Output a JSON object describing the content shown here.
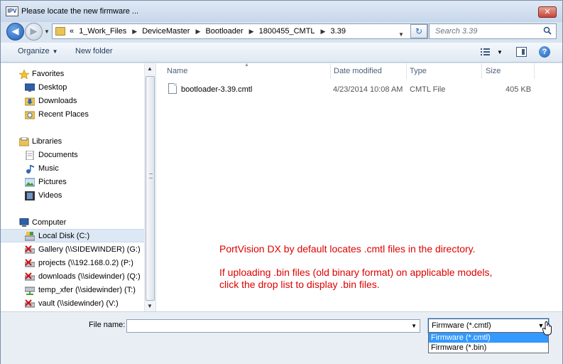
{
  "window": {
    "app_icon_text": "IPV",
    "title": "Please locate the new firmware ...",
    "close_label": "✕"
  },
  "address_bar": {
    "crumbs": [
      "«",
      "1_Work_Files",
      "DeviceMaster",
      "Bootloader",
      "1800455_CMTL",
      "3.39"
    ],
    "search_placeholder": "Search 3.39"
  },
  "toolbar": {
    "organize_label": "Organize",
    "new_folder_label": "New folder"
  },
  "nav": {
    "favorites": {
      "label": "Favorites",
      "icon": "star-icon",
      "items": [
        {
          "label": "Desktop",
          "icon": "desktop-icon"
        },
        {
          "label": "Downloads",
          "icon": "downloads-folder-icon"
        },
        {
          "label": "Recent Places",
          "icon": "recent-places-icon"
        }
      ]
    },
    "libraries": {
      "label": "Libraries",
      "icon": "libraries-icon",
      "items": [
        {
          "label": "Documents",
          "icon": "documents-icon"
        },
        {
          "label": "Music",
          "icon": "music-icon"
        },
        {
          "label": "Pictures",
          "icon": "pictures-icon"
        },
        {
          "label": "Videos",
          "icon": "videos-icon"
        }
      ]
    },
    "computer": {
      "label": "Computer",
      "icon": "computer-icon",
      "items": [
        {
          "label": "Local Disk (C:)",
          "icon": "local-disk-icon",
          "selected": true
        },
        {
          "label": "Gallery (\\\\SIDEWINDER) (G:)",
          "icon": "network-drive-disconnected-icon"
        },
        {
          "label": "projects (\\\\192.168.0.2) (P:)",
          "icon": "network-drive-disconnected-icon"
        },
        {
          "label": "downloads (\\\\sidewinder) (Q:)",
          "icon": "network-drive-disconnected-icon"
        },
        {
          "label": "temp_xfer (\\\\sidewinder) (T:)",
          "icon": "network-drive-icon"
        },
        {
          "label": "vault (\\\\sidewinder) (V:)",
          "icon": "network-drive-disconnected-icon"
        }
      ]
    }
  },
  "columns": {
    "name": "Name",
    "date": "Date modified",
    "type": "Type",
    "size": "Size"
  },
  "files": [
    {
      "name": "bootloader-3.39.cmtl",
      "date": "4/23/2014 10:08 AM",
      "type": "CMTL File",
      "size": "405 KB"
    }
  ],
  "annotation": {
    "line1": "PortVision DX by default locates .cmtl files in the directory.",
    "line2": "If uploading .bin files (old binary format) on applicable models,",
    "line3": "click the drop list to display .bin files."
  },
  "bottom": {
    "file_name_label": "File name:",
    "file_name_value": "",
    "file_type_selected": "Firmware (*.cmtl)",
    "file_type_options": [
      "Firmware (*.cmtl)",
      "Firmware (*.bin)"
    ]
  },
  "colors": {
    "annotation": "#e00000",
    "highlight": "#3399ff"
  }
}
